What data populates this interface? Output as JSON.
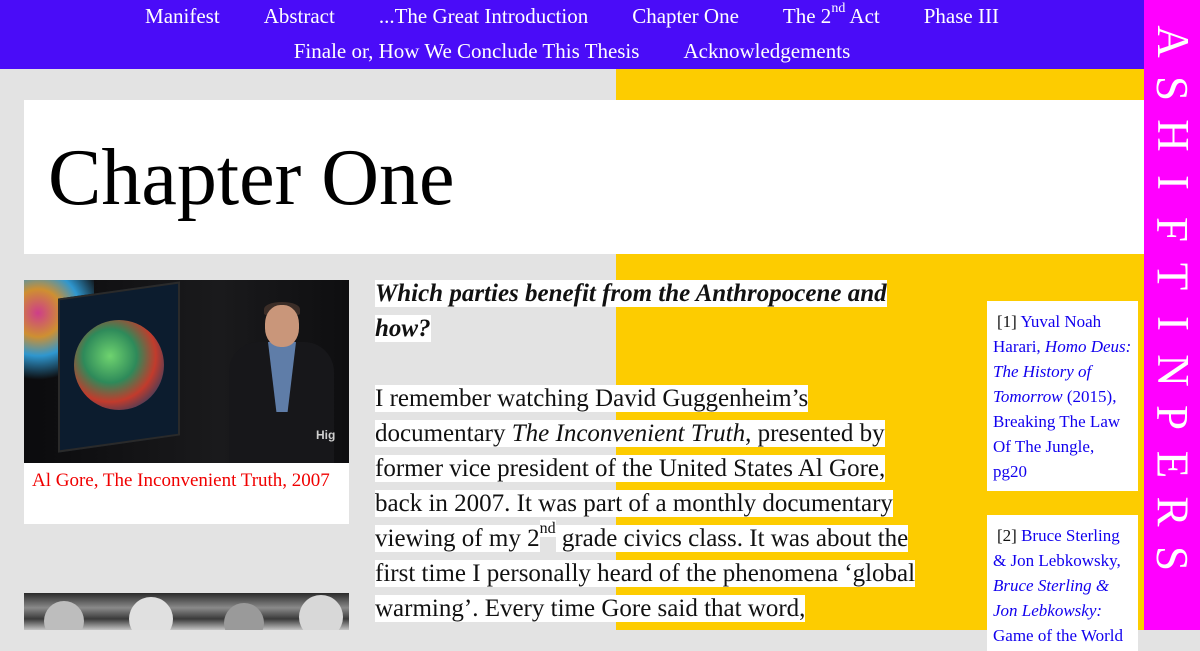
{
  "nav": {
    "row1": [
      {
        "label": "Manifest"
      },
      {
        "label": "Abstract"
      },
      {
        "label": "...The Great Introduction"
      },
      {
        "label": "Chapter One"
      },
      {
        "label_pre": "The 2",
        "label_sup": "nd",
        "label_post": " Act"
      },
      {
        "label": "Phase III"
      }
    ],
    "row2": [
      {
        "label": "Finale or, How We Conclude This Thesis"
      },
      {
        "label": "Acknowledgements"
      }
    ]
  },
  "side": {
    "letters": [
      "A",
      "S",
      "H",
      "I",
      "F",
      "T",
      "I",
      "N",
      "P",
      "E",
      "R",
      "S"
    ]
  },
  "page": {
    "title": "Chapter One"
  },
  "figures": {
    "photo1_stage_text": "Hig",
    "caption1": "Al Gore, The Inconvenient Truth, 2007"
  },
  "content": {
    "question": "Which parties benefit from the Anthropocene and how?",
    "p1_a": "I remember watching David Guggenheim’s documentary ",
    "p1_title": "The Inconvenient Truth",
    "p1_b": ", presented by former vice president of the United States Al Gore, back in 2007. It was part of a monthly documentary viewing of my 2",
    "p1_sup": "nd",
    "p1_c": " grade civics class. It was about the first time I personally heard of the phenomena ‘global warming’. Every time Gore said that word,"
  },
  "footnotes": [
    {
      "num": "[1]",
      "author": "Yuval Noah Harari, ",
      "title": "Homo Deus: The History of Tomorrow",
      "rest": " (2015), Breaking The Law Of The Jungle, pg20"
    },
    {
      "num": "[2]",
      "author": "Bruce Sterling & Jon Lebkowsky, ",
      "title": "Bruce Sterling & Jon Lebkowsky: ",
      "rest": "Game of the World"
    }
  ],
  "colors": {
    "nav_bg": "#4a0cf8",
    "side_bg": "#ff00ff",
    "accent_yellow": "#fdcc00",
    "caption_red": "#f00000",
    "link_blue": "#1100ee"
  }
}
